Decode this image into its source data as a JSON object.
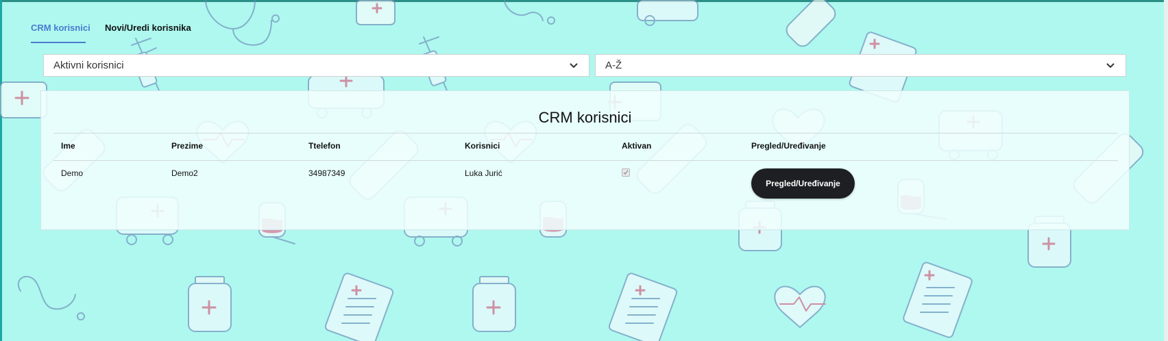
{
  "tabs": [
    {
      "label": "CRM korisnici",
      "active": true
    },
    {
      "label": "Novi/Uredi korisnika",
      "active": false
    }
  ],
  "filters": {
    "status_select": {
      "value": "Aktivni korisnici"
    },
    "sort_select": {
      "value": "A-Ž"
    }
  },
  "panel": {
    "title": "CRM korisnici",
    "columns": [
      "Ime",
      "Prezime",
      "Ttelefon",
      "Korisnici",
      "Aktivan",
      "Pregled/Uređivanje"
    ],
    "rows": [
      {
        "ime": "Demo",
        "prezime": "Demo2",
        "telefon": "34987349",
        "korisnici": "Luka Jurić",
        "aktivan": true,
        "action_label": "Pregled/Uređivanje"
      }
    ]
  },
  "colors": {
    "background": "#aef8ef",
    "accent": "#4a7bd0",
    "button": "#1e1f23"
  }
}
